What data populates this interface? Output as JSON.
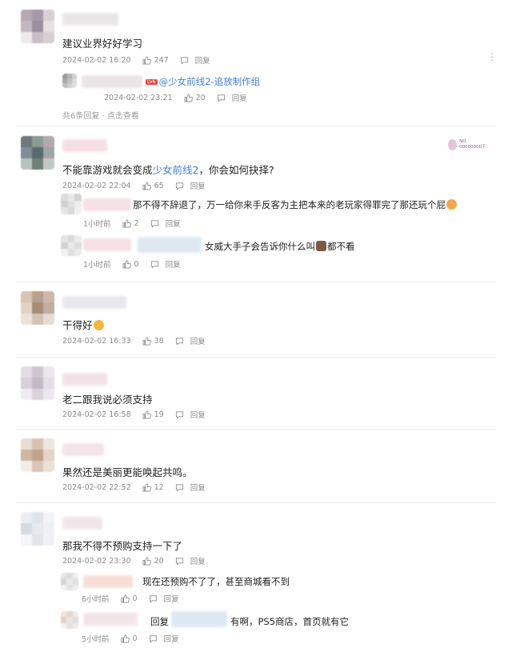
{
  "comments": [
    {
      "text": "建议业界好好学习",
      "time": "2024-02-02 16:20",
      "likes": "247",
      "reply_label": "回复",
      "replies": [
        {
          "text_prefix": "@少女前线2-追放制作组",
          "time": "2024-02-02 23:21",
          "likes": "20",
          "reply_label": "回复"
        }
      ],
      "more_text": "共6条回复 · 点击查看"
    },
    {
      "text_before": "不能靠游戏就会变成",
      "text_link": "少女前线2",
      "text_after": "，你会如何抉择?",
      "time": "2024-02-02 22:04",
      "likes": "65",
      "reply_label": "回复",
      "replies": [
        {
          "text": "那不得不辞退了，万一给你来手反客为主把本来的老玩家得罪完了那还玩个屁",
          "time": "1小时前",
          "likes": "2",
          "reply_label": "回复"
        },
        {
          "text_before": "女威大手子会告诉你什么叫",
          "text_after": "都不看",
          "time": "1小时前",
          "likes": "0",
          "reply_label": "回复"
        }
      ]
    },
    {
      "text": "干得好",
      "time": "2024-02-02 16:33",
      "likes": "38",
      "reply_label": "回复"
    },
    {
      "text": "老二跟我说必须支持",
      "time": "2024-02-02 16:58",
      "likes": "19",
      "reply_label": "回复"
    },
    {
      "text": "果然还是美丽更能唤起共鸣。",
      "time": "2024-02-02 22:52",
      "likes": "12",
      "reply_label": "回复"
    },
    {
      "text": "那我不得不预购支持一下了",
      "time": "2024-02-02 23:30",
      "likes": "20",
      "reply_label": "回复",
      "replies": [
        {
          "text": "现在还预购不了了，甚至商城看不到",
          "time": "6小时前",
          "likes": "0",
          "reply_label": "回复"
        },
        {
          "text_prefix": "回复",
          "text": "有啊，PS5商店，首页就有它",
          "time": "5小时前",
          "likes": "0",
          "reply_label": "回复"
        }
      ]
    }
  ],
  "badge_text": "NO. 00000000下",
  "colors": {
    "link": "#3d7fd6",
    "meta": "#8a8a8a",
    "divider": "#ececec"
  }
}
